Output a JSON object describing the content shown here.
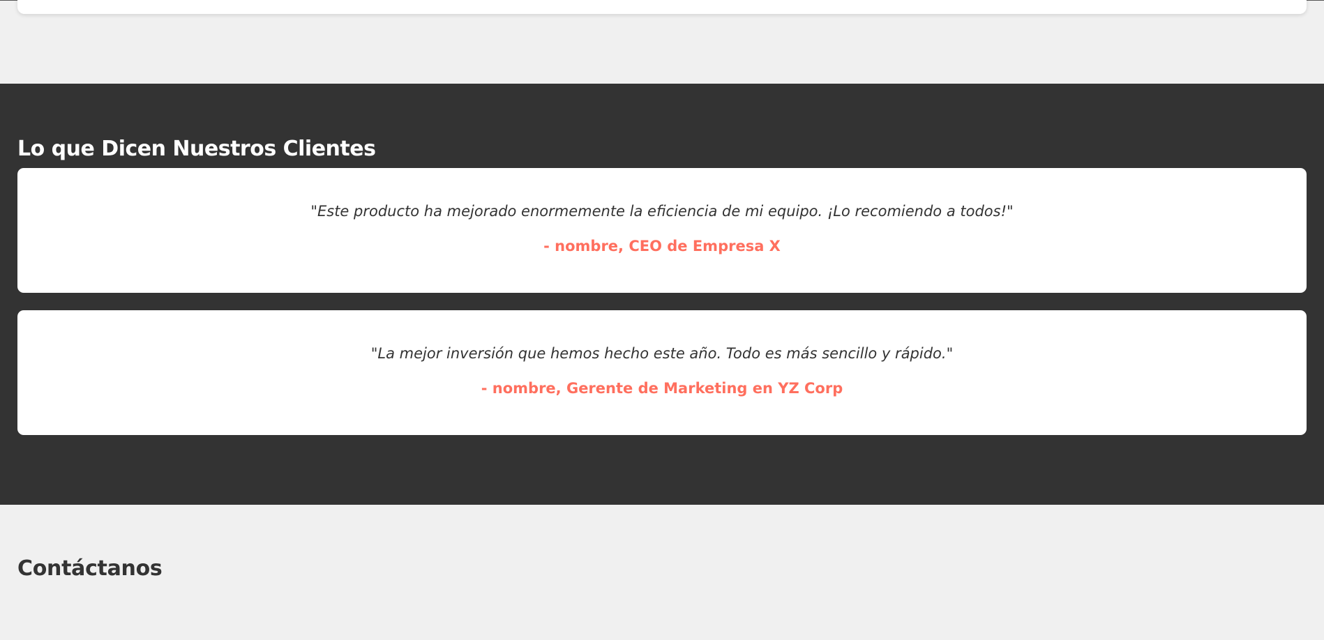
{
  "testimonials": {
    "title": "Lo que Dicen Nuestros Clientes",
    "items": [
      {
        "quote": "\"Este producto ha mejorado enormemente la eficiencia de mi equipo. ¡Lo recomiendo a todos!\"",
        "author": "- nombre, CEO de Empresa X"
      },
      {
        "quote": "\"La mejor inversión que hemos hecho este año. Todo es más sencillo y rápido.\"",
        "author": "- nombre, Gerente de Marketing en YZ Corp"
      }
    ]
  },
  "contact": {
    "title": "Contáctanos"
  },
  "colors": {
    "page_background": "#f0f0f0",
    "section_dark": "#333333",
    "card_background": "#ffffff",
    "accent": "#ff6f5e",
    "text_dark": "#333333"
  }
}
